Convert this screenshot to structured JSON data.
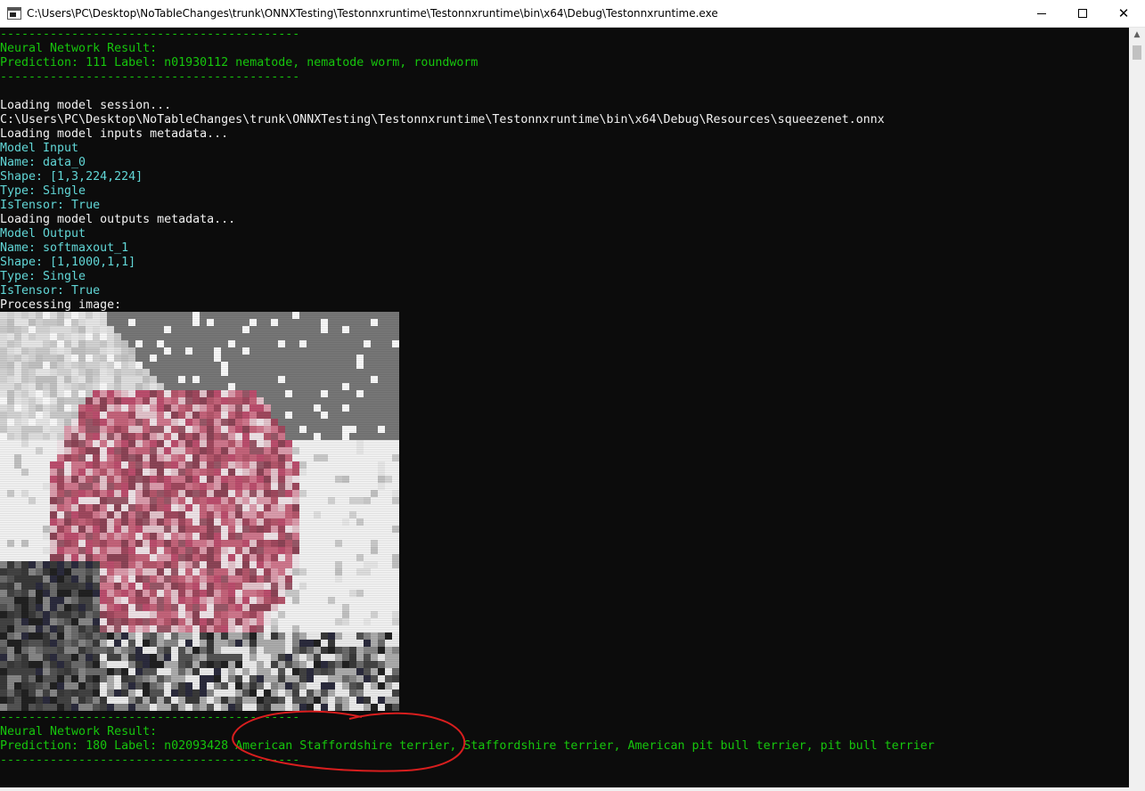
{
  "window": {
    "title": "C:\\Users\\PC\\Desktop\\NoTableChanges\\trunk\\ONNXTesting\\Testonnxruntime\\Testonnxruntime\\bin\\x64\\Debug\\Testonnxruntime.exe",
    "minimize_glyph": "—",
    "maximize_glyph": "☐",
    "close_glyph": "✕"
  },
  "colors": {
    "console_bg": "#0c0c0c",
    "green": "#16c60c",
    "white": "#f2f2f2",
    "cyan": "#61d6d6",
    "annotation_red": "#d81e1e"
  },
  "console": {
    "lines": [
      {
        "text": "------------------------------------------",
        "color": "green"
      },
      {
        "text": "Neural Network Result:",
        "color": "green"
      },
      {
        "text": "Prediction: 111 Label: n01930112 nematode, nematode worm, roundworm",
        "color": "green"
      },
      {
        "text": "------------------------------------------",
        "color": "green"
      },
      {
        "text": "",
        "color": "white"
      },
      {
        "text": "Loading model session...",
        "color": "white"
      },
      {
        "text": "C:\\Users\\PC\\Desktop\\NoTableChanges\\trunk\\ONNXTesting\\Testonnxruntime\\Testonnxruntime\\bin\\x64\\Debug\\Resources\\squeezenet.onnx",
        "color": "white"
      },
      {
        "text": "Loading model inputs metadata...",
        "color": "white"
      },
      {
        "text": "Model Input",
        "color": "cyan"
      },
      {
        "text": "Name: data_0",
        "color": "cyan"
      },
      {
        "text": "Shape: [1,3,224,224]",
        "color": "cyan"
      },
      {
        "text": "Type: Single",
        "color": "cyan"
      },
      {
        "text": "IsTensor: True",
        "color": "cyan"
      },
      {
        "text": "Loading model outputs metadata...",
        "color": "white"
      },
      {
        "text": "Model Output",
        "color": "cyan"
      },
      {
        "text": "Name: softmaxout_1",
        "color": "cyan"
      },
      {
        "text": "Shape: [1,1000,1,1]",
        "color": "cyan"
      },
      {
        "text": "Type: Single",
        "color": "cyan"
      },
      {
        "text": "IsTensor: True",
        "color": "cyan"
      },
      {
        "text": "Processing image:",
        "color": "white"
      }
    ],
    "after_image_lines": [
      {
        "text": "------------------------------------------",
        "color": "green"
      },
      {
        "text": "Neural Network Result:",
        "color": "green"
      },
      {
        "text": "Prediction: 180 Label: n02093428 American Staffordshire terrier, Staffordshire terrier, American pit bull terrier, pit bull terrier",
        "color": "green"
      },
      {
        "text": "------------------------------------------",
        "color": "green"
      }
    ],
    "image_description": "pixelated ASCII-art rendering of processed dog image"
  },
  "scrollbar": {
    "up_glyph": "▲"
  }
}
